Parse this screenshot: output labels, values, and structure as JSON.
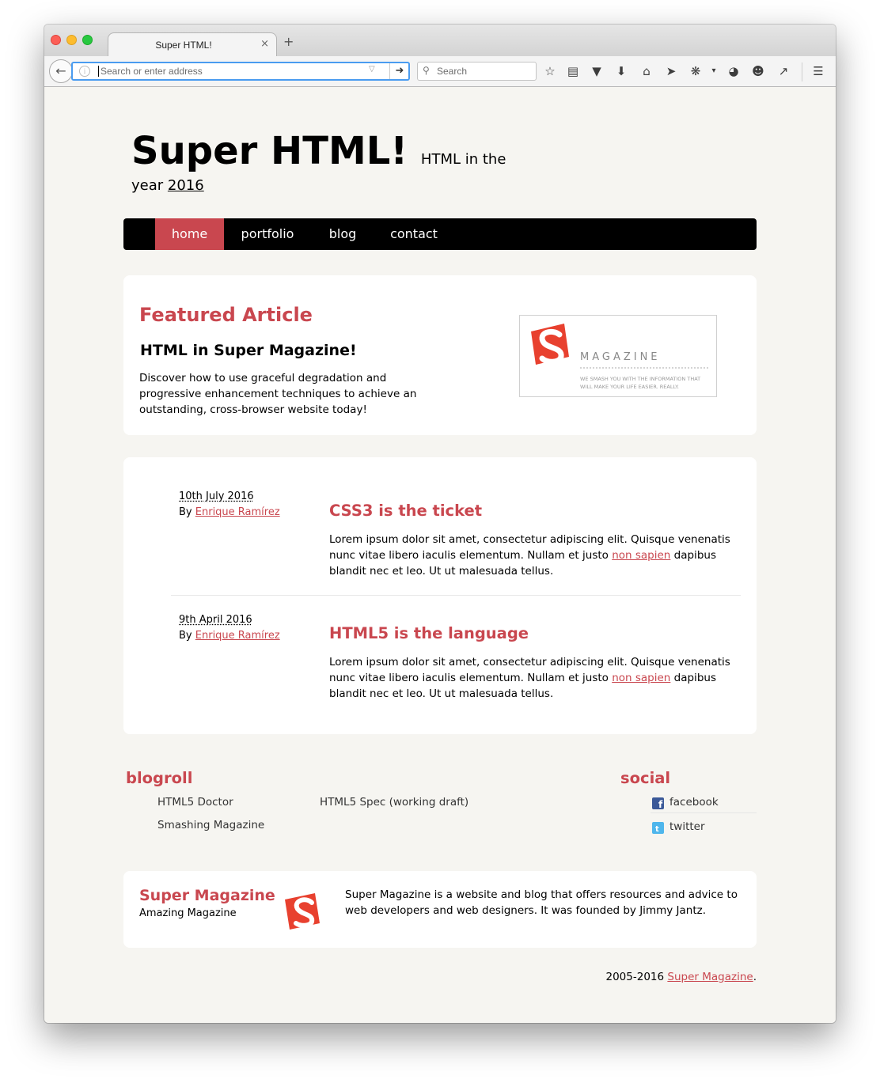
{
  "browser": {
    "tab_title": "Super HTML!",
    "tab_close": "×",
    "new_tab": "+",
    "url_placeholder": "Search or enter address",
    "search_placeholder": "Search"
  },
  "site": {
    "title": "Super HTML!",
    "tagline": "HTML in the",
    "year_prefix": "year",
    "year": "2016"
  },
  "nav": {
    "items": [
      {
        "label": "home",
        "active": true
      },
      {
        "label": "portfolio",
        "active": false
      },
      {
        "label": "blog",
        "active": false
      },
      {
        "label": "contact",
        "active": false
      }
    ]
  },
  "featured": {
    "heading": "Featured Article",
    "title": "HTML in Super Magazine!",
    "description": "Discover how to use graceful degradation and progressive enhancement techniques to achieve an outstanding, cross-browser website today!",
    "logo_word": "MAGAZINE",
    "logo_tagline_1": "WE SMASH YOU WITH THE INFORMATION THAT",
    "logo_tagline_2": "WILL MAKE YOUR LIFE EASIER. REALLY."
  },
  "posts": [
    {
      "date": "10th July 2016",
      "by": "By",
      "author": "Enrique Ramírez",
      "title": "CSS3 is the ticket",
      "text_before": "Lorem ipsum dolor sit amet, consectetur adipiscing elit. Quisque venenatis nunc vitae libero iaculis elementum. Nullam et justo ",
      "link": "non sapien",
      "text_after": " dapibus blandit nec et leo. Ut ut malesuada tellus."
    },
    {
      "date": "9th April 2016",
      "by": "By",
      "author": "Enrique Ramírez",
      "title": "HTML5 is the language",
      "text_before": "Lorem ipsum dolor sit amet, consectetur adipiscing elit. Quisque venenatis nunc vitae libero iaculis elementum. Nullam et justo ",
      "link": "non sapien",
      "text_after": " dapibus blandit nec et leo. Ut ut malesuada tellus."
    }
  ],
  "blogroll": {
    "heading": "blogroll",
    "links": [
      "HTML5 Doctor",
      "HTML5 Spec (working draft)",
      "Smashing Magazine"
    ]
  },
  "social": {
    "heading": "social",
    "items": [
      {
        "label": "facebook",
        "icon": "facebook-icon",
        "color": "#3b5998"
      },
      {
        "label": "twitter",
        "icon": "twitter-icon",
        "color": "#4fb6ec"
      }
    ]
  },
  "footer": {
    "brand": "Super Magazine",
    "tag": "Amazing Magazine",
    "description": "Super Magazine is a website and blog that offers resources and advice to web developers and web designers. It was founded by Jimmy Jantz.",
    "copyright_years": "2005-2016",
    "copyright_link": "Super Magazine",
    "copyright_end": "."
  },
  "colors": {
    "accent": "#c9474f",
    "nav_bg": "#000000",
    "page_bg": "#f6f5f1",
    "card_bg": "#ffffff"
  }
}
